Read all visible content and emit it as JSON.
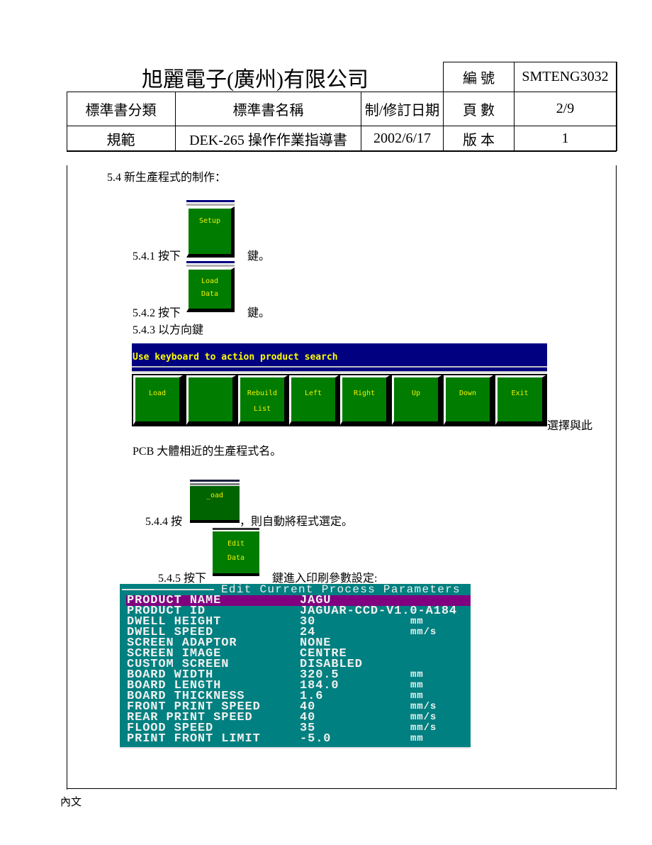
{
  "header": {
    "company": "旭麗電子(廣州)有限公司",
    "code_label": "編 號",
    "code_value": "SMTENG3032",
    "row1": [
      "標準書分類",
      "標準書名稱",
      "制/修訂日期",
      "頁 數",
      "2/9"
    ],
    "row2": [
      "規範",
      "DEK-265 操作作業指導書",
      "2002/6/17",
      "版 本",
      "1"
    ]
  },
  "body": {
    "section": "5.4  新生產程式的制作：",
    "step1": {
      "prefix": "5.4.1 按下",
      "suffix": "鍵。",
      "key": [
        "Setup"
      ]
    },
    "step2": {
      "prefix": "5.4.2 按下",
      "suffix": "鍵。",
      "key": [
        "Load",
        "Data"
      ]
    },
    "step3": {
      "prefix": "5.4.3 以方向鍵",
      "suffix": "選擇與此",
      "line2": "PCB 大體相近的生產程式名。"
    },
    "toolbar": {
      "message": "Use keyboard to action product search",
      "buttons": [
        [
          "Load"
        ],
        [
          ""
        ],
        [
          "Rebuild",
          "List"
        ],
        [
          "Left"
        ],
        [
          "Right"
        ],
        [
          "Up"
        ],
        [
          "Down"
        ],
        [
          "Exit"
        ]
      ]
    },
    "step4": {
      "prefix": "5.4.4  按",
      "suffix": "，則自動將程式選定。",
      "key": [
        "_oad"
      ]
    },
    "step5": {
      "prefix": "5.4.5 按下",
      "suffix": "鍵進入印刷參數設定:",
      "key": [
        "Edit",
        "Data"
      ]
    },
    "params": {
      "title": "Edit Current Process Parameters",
      "highlight_color": "#800080",
      "background_color": "#008080",
      "rows": [
        [
          "PRODUCT NAME",
          "JAGU",
          ""
        ],
        [
          "PRODUCT ID",
          "JAGUAR-CCD-V1.0-A184",
          ""
        ],
        [
          "DWELL HEIGHT",
          "30",
          "mm"
        ],
        [
          "DWELL SPEED",
          "24",
          "mm/s"
        ],
        [
          "SCREEN ADAPTOR",
          "NONE",
          ""
        ],
        [
          "SCREEN IMAGE",
          "CENTRE",
          ""
        ],
        [
          "CUSTOM SCREEN",
          "DISABLED",
          ""
        ],
        [
          "BOARD WIDTH",
          "320.5",
          "mm"
        ],
        [
          "BOARD LENGTH",
          "184.0",
          "mm"
        ],
        [
          "BOARD THICKNESS",
          "1.6",
          "mm"
        ],
        [
          "FRONT PRINT SPEED",
          "40",
          "mm/s"
        ],
        [
          "REAR PRINT SPEED",
          "40",
          "mm/s"
        ],
        [
          "FLOOD SPEED",
          "35",
          "mm/s"
        ],
        [
          "PRINT FRONT LIMIT",
          "-5.0",
          "mm"
        ]
      ]
    }
  },
  "footer": {
    "label": "內文"
  }
}
